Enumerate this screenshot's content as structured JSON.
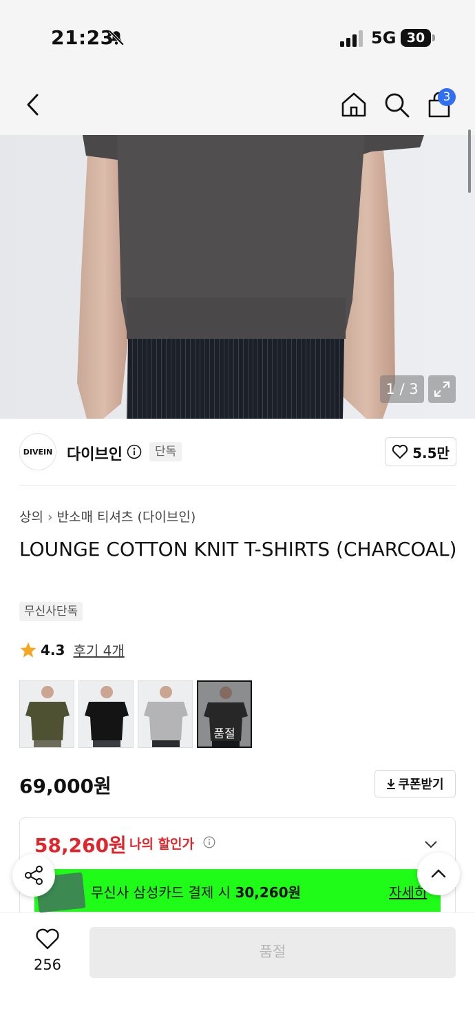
{
  "status_bar": {
    "time": "21:23",
    "network": "5G",
    "battery": "30"
  },
  "nav": {
    "cart_count": "3"
  },
  "gallery": {
    "counter": "1 / 3"
  },
  "brand": {
    "logo_text": "DIVEIN",
    "name": "다이브인",
    "tag": "단독",
    "likes": "5.5만"
  },
  "product": {
    "breadcrumb": [
      "상의",
      "반소매 티셔츠 (다이브인)"
    ],
    "title": "LOUNGE COTTON KNIT T-SHIRTS (CHARCOAL)",
    "badge": "무신사단독",
    "rating": "4.3",
    "reviews": "후기 4개",
    "swatches": [
      {
        "color": "olive",
        "sold_out": false
      },
      {
        "color": "black",
        "sold_out": false
      },
      {
        "color": "gray",
        "sold_out": false
      },
      {
        "color": "charcoal",
        "sold_out": true,
        "label": "품절"
      }
    ],
    "price": "69,000원",
    "coupon": "쿠폰받기",
    "discount_price": "58,260원",
    "discount_label": "나의 할인가",
    "card_promo_prefix": "무신사 삼성카드 결제 시 ",
    "card_promo_amount": "30,260원",
    "card_detail": "자세히"
  },
  "bottom": {
    "wish_count": "256",
    "buy_label": "품절"
  },
  "colors": {
    "accent_red": "#e2242b",
    "badge_blue": "#2f6ff0",
    "promo_green": "#1efc17"
  }
}
